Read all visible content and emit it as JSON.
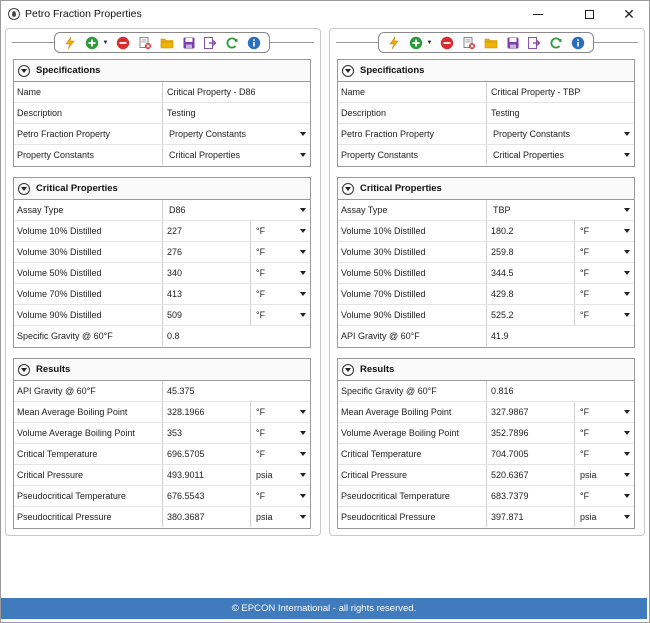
{
  "window": {
    "title": "Petro Fraction Properties"
  },
  "toolbar_icons": [
    "lightning-icon",
    "add-icon",
    "remove-icon",
    "delete-list-icon",
    "open-folder-icon",
    "save-icon",
    "export-icon",
    "refresh-icon",
    "info-icon"
  ],
  "colors": {
    "footer_bg": "#3f7bbd",
    "add": "#2e9b3a",
    "remove": "#d92c2c",
    "info": "#2a6fbf",
    "lightning": "#f2a900"
  },
  "panels": [
    {
      "specifications": {
        "title": "Specifications",
        "rows": [
          {
            "label": "Name",
            "value": "Critical Property - D86"
          },
          {
            "label": "Description",
            "value": "Testing"
          },
          {
            "label": "Petro Fraction Property",
            "value": "Property Constants"
          },
          {
            "label": "Property Constants",
            "value": "Critical Properties"
          }
        ]
      },
      "critical": {
        "title": "Critical Properties",
        "assay": {
          "label": "Assay Type",
          "value": "D86"
        },
        "rows": [
          {
            "label": "Volume 10% Distilled",
            "value": "227",
            "unit": "°F"
          },
          {
            "label": "Volume 30% Distilled",
            "value": "276",
            "unit": "°F"
          },
          {
            "label": "Volume 50% Distilled",
            "value": "340",
            "unit": "°F"
          },
          {
            "label": "Volume 70% Distilled",
            "value": "413",
            "unit": "°F"
          },
          {
            "label": "Volume 90% Distilled",
            "value": "509",
            "unit": "°F"
          }
        ],
        "last": {
          "label": "Specific Gravity @ 60°F",
          "value": "0.8"
        }
      },
      "results": {
        "title": "Results",
        "first": {
          "label": "API Gravity @ 60°F",
          "value": "45.375"
        },
        "rows": [
          {
            "label": "Mean Average Boiling Point",
            "value": "328.1966",
            "unit": "°F"
          },
          {
            "label": "Volume Average Boiling Point",
            "value": "353",
            "unit": "°F"
          },
          {
            "label": "Critical Temperature",
            "value": "696.5705",
            "unit": "°F"
          },
          {
            "label": "Critical Pressure",
            "value": "493.9011",
            "unit": "psia"
          },
          {
            "label": "Pseudocritical Temperature",
            "value": "676.5543",
            "unit": "°F"
          },
          {
            "label": "Pseudocritical Pressure",
            "value": "380.3687",
            "unit": "psia"
          }
        ]
      }
    },
    {
      "specifications": {
        "title": "Specifications",
        "rows": [
          {
            "label": "Name",
            "value": "Critical Property - TBP"
          },
          {
            "label": "Description",
            "value": "Testing"
          },
          {
            "label": "Petro Fraction Property",
            "value": "Property Constants"
          },
          {
            "label": "Property Constants",
            "value": "Critical Properties"
          }
        ]
      },
      "critical": {
        "title": "Critical Properties",
        "assay": {
          "label": "Assay Type",
          "value": "TBP"
        },
        "rows": [
          {
            "label": "Volume 10% Distilled",
            "value": "180.2",
            "unit": "°F"
          },
          {
            "label": "Volume 30% Distilled",
            "value": "259.8",
            "unit": "°F"
          },
          {
            "label": "Volume 50% Distilled",
            "value": "344.5",
            "unit": "°F"
          },
          {
            "label": "Volume 70% Distilled",
            "value": "429.8",
            "unit": "°F"
          },
          {
            "label": "Volume 90% Distilled",
            "value": "525.2",
            "unit": "°F"
          }
        ],
        "last": {
          "label": "API Gravity @ 60°F",
          "value": "41.9"
        }
      },
      "results": {
        "title": "Results",
        "first": {
          "label": "Specific Gravity @ 60°F",
          "value": "0.816"
        },
        "rows": [
          {
            "label": "Mean Average Boiling Point",
            "value": "327.9867",
            "unit": "°F"
          },
          {
            "label": "Volume Average Boiling Point",
            "value": "352.7896",
            "unit": "°F"
          },
          {
            "label": "Critical Temperature",
            "value": "704.7005",
            "unit": "°F"
          },
          {
            "label": "Critical Pressure",
            "value": "520.6367",
            "unit": "psia"
          },
          {
            "label": "Pseudocritical Temperature",
            "value": "683.7379",
            "unit": "°F"
          },
          {
            "label": "Pseudocritical Pressure",
            "value": "397.871",
            "unit": "psia"
          }
        ]
      }
    }
  ],
  "footer": {
    "text": "© EPCON International - all rights reserved."
  }
}
